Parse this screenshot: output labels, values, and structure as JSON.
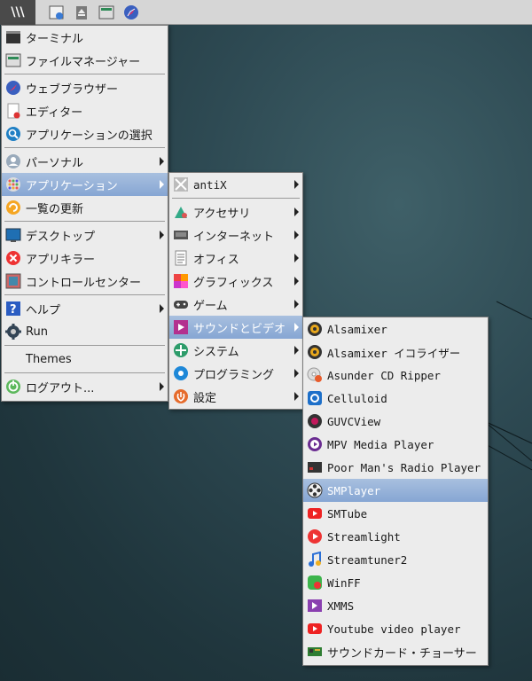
{
  "taskbar": {
    "menu_button_label": "\\\\\\",
    "icons": [
      "terminal-icon",
      "file-manager-icon",
      "eject-icon",
      "folder-icon",
      "web-browser-icon"
    ]
  },
  "colors": {
    "highlight": "#93b0d8",
    "menu_bg": "#ececec",
    "desktop": "#2e4a53",
    "taskbar": "#d6d6d6"
  },
  "main_menu": {
    "items": [
      {
        "label": "ターミナル",
        "icon": "terminal-icon"
      },
      {
        "label": "ファイルマネージャー",
        "icon": "file-manager-icon"
      },
      {
        "label": "ウェブブラウザー",
        "icon": "web-browser-icon"
      },
      {
        "label": "エディター",
        "icon": "editor-icon"
      },
      {
        "label": "アプリケーションの選択",
        "icon": "app-select-icon"
      },
      {
        "label": "パーソナル",
        "icon": "personal-icon"
      },
      {
        "label": "アプリケーション",
        "icon": "applications-icon"
      },
      {
        "label": "一覧の更新",
        "icon": "refresh-icon"
      },
      {
        "label": "デスクトップ",
        "icon": "desktop-icon"
      },
      {
        "label": "アプリキラー",
        "icon": "app-killer-icon"
      },
      {
        "label": "コントロールセンター",
        "icon": "control-center-icon"
      },
      {
        "label": "ヘルプ",
        "icon": "help-icon"
      },
      {
        "label": "Run",
        "icon": "run-icon"
      },
      {
        "label": "Themes",
        "icon": ""
      },
      {
        "label": "ログアウト...",
        "icon": "logout-icon"
      }
    ]
  },
  "apps_menu": {
    "items": [
      {
        "label": "antiX",
        "icon": "antix-icon"
      },
      {
        "label": "アクセサリ",
        "icon": "accessories-icon"
      },
      {
        "label": "インターネット",
        "icon": "internet-icon"
      },
      {
        "label": "オフィス",
        "icon": "office-icon"
      },
      {
        "label": "グラフィックス",
        "icon": "graphics-icon"
      },
      {
        "label": "ゲーム",
        "icon": "games-icon"
      },
      {
        "label": "サウンドとビデオ",
        "icon": "sound-video-icon"
      },
      {
        "label": "システム",
        "icon": "system-icon"
      },
      {
        "label": "プログラミング",
        "icon": "programming-icon"
      },
      {
        "label": "設定",
        "icon": "settings-icon"
      }
    ]
  },
  "sound_video_menu": {
    "items": [
      {
        "label": "Alsamixer",
        "icon": "alsamixer-icon"
      },
      {
        "label": "Alsamixer イコライザー",
        "icon": "alsamixer-eq-icon"
      },
      {
        "label": "Asunder CD Ripper",
        "icon": "cd-ripper-icon"
      },
      {
        "label": "Celluloid",
        "icon": "celluloid-icon"
      },
      {
        "label": "GUVCView",
        "icon": "webcam-icon"
      },
      {
        "label": "MPV Media Player",
        "icon": "mpv-icon"
      },
      {
        "label": "Poor Man's Radio Player",
        "icon": "radio-icon"
      },
      {
        "label": "SMPlayer",
        "icon": "smplayer-icon"
      },
      {
        "label": "SMTube",
        "icon": "smtube-icon"
      },
      {
        "label": "Streamlight",
        "icon": "streamlight-icon"
      },
      {
        "label": "Streamtuner2",
        "icon": "music-note-icon"
      },
      {
        "label": "WinFF",
        "icon": "winff-icon"
      },
      {
        "label": "XMMS",
        "icon": "xmms-icon"
      },
      {
        "label": "Youtube video player",
        "icon": "youtube-icon"
      },
      {
        "label": "サウンドカード・チョーサー",
        "icon": "sound-card-icon"
      }
    ]
  }
}
